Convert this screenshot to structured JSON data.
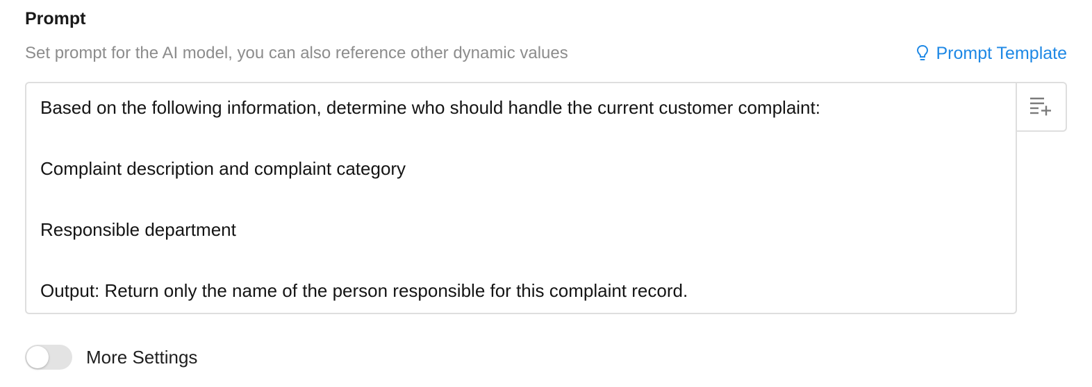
{
  "prompt_section": {
    "title": "Prompt",
    "description": "Set prompt for the AI model, you can also reference other dynamic values",
    "template_link": {
      "label": "Prompt Template",
      "icon": "lightbulb-icon",
      "color": "#1e88e5"
    },
    "editor": {
      "lines": [
        "Based on the following information, determine who should handle the current customer complaint:",
        "Complaint description and complaint category",
        "Responsible department",
        "Output: Return only the name of the person responsible for this complaint record."
      ]
    },
    "insert_button": {
      "icon": "insert-variable-icon"
    }
  },
  "more_settings": {
    "label": "More Settings",
    "enabled": false
  }
}
